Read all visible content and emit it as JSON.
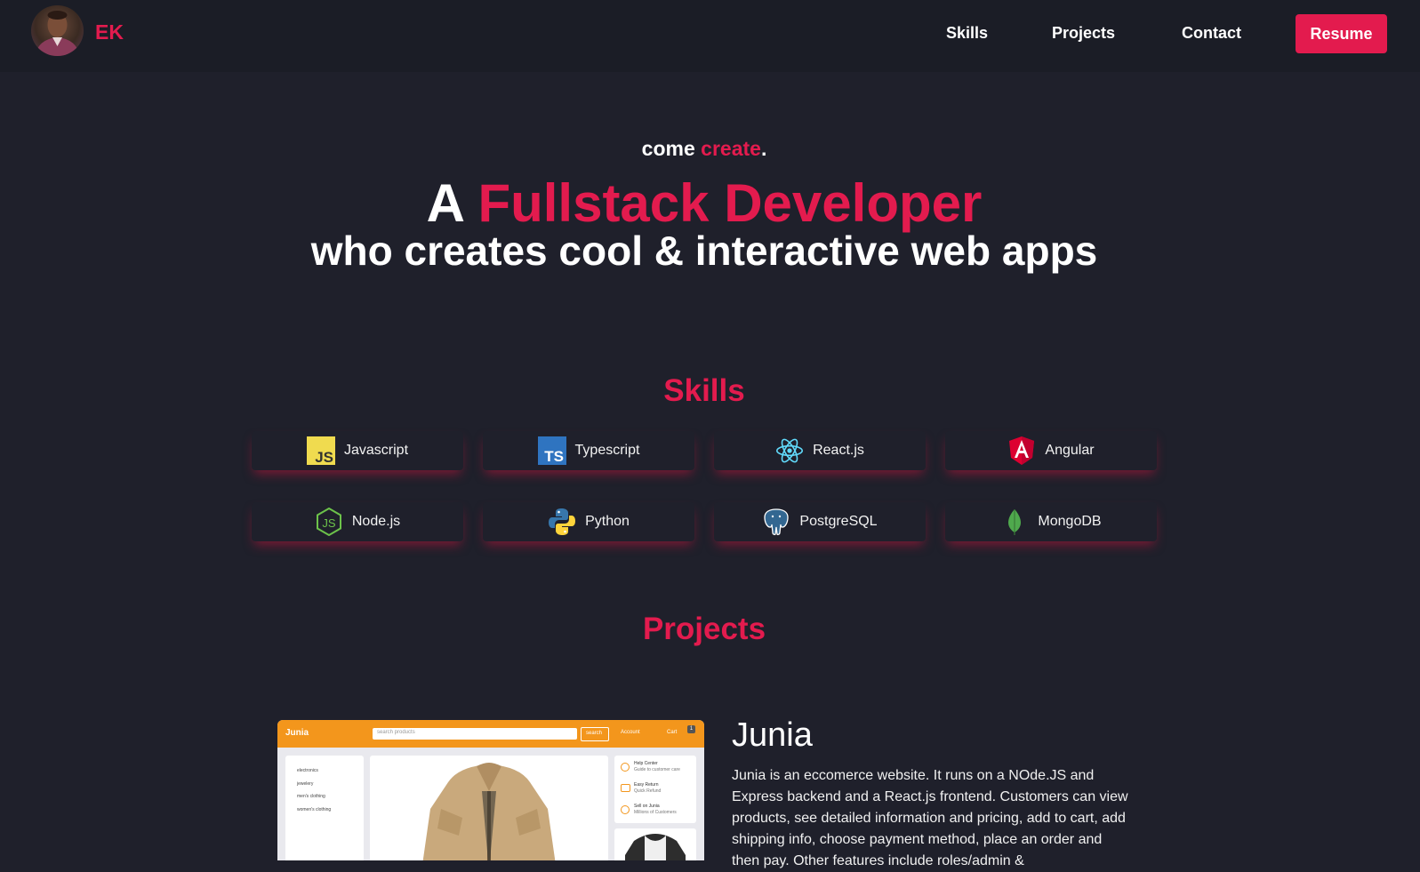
{
  "nav": {
    "brand": "EK",
    "links": [
      "Skills",
      "Projects",
      "Contact"
    ],
    "resume_label": "Resume"
  },
  "hero": {
    "small_prefix": "come ",
    "small_accent": "create",
    "small_suffix": ".",
    "title_prefix": "A ",
    "title_accent": "Fullstack Developer",
    "subtitle": "who creates cool & interactive web apps"
  },
  "skills": {
    "title": "Skills",
    "items": [
      {
        "label": "Javascript",
        "icon": "javascript-icon"
      },
      {
        "label": "Typescript",
        "icon": "typescript-icon"
      },
      {
        "label": "React.js",
        "icon": "react-icon"
      },
      {
        "label": "Angular",
        "icon": "angular-icon"
      },
      {
        "label": "Node.js",
        "icon": "nodejs-icon"
      },
      {
        "label": "Python",
        "icon": "python-icon"
      },
      {
        "label": "PostgreSQL",
        "icon": "postgresql-icon"
      },
      {
        "label": "MongoDB",
        "icon": "mongodb-icon"
      }
    ]
  },
  "projects": {
    "title": "Projects",
    "items": [
      {
        "name": "Junia",
        "description": "Junia is an eccomerce website. It runs on a NOde.JS and Express backend and a React.js frontend. Customers can view products, see detailed information and pricing, add to cart, add shipping info, choose payment method, place an order and then pay. Other features include roles/admin &",
        "screenshot": {
          "brand": "Junia",
          "search_placeholder": "search products",
          "search_button": "search",
          "account": "Account",
          "cart": "Cart",
          "cart_count": "1",
          "categories": [
            "electronics",
            "jewelery",
            "men's clothing",
            "women's clothing"
          ],
          "help": [
            {
              "title": "Help Center",
              "sub": "Guide to customer care"
            },
            {
              "title": "Easy Return",
              "sub": "Quick Refund"
            },
            {
              "title": "Sell on Junia",
              "sub": "Millions of Customers"
            }
          ]
        }
      }
    ]
  },
  "colors": {
    "accent": "#e31b4e",
    "background": "#1f202b",
    "nav_background": "#1b1d26"
  }
}
